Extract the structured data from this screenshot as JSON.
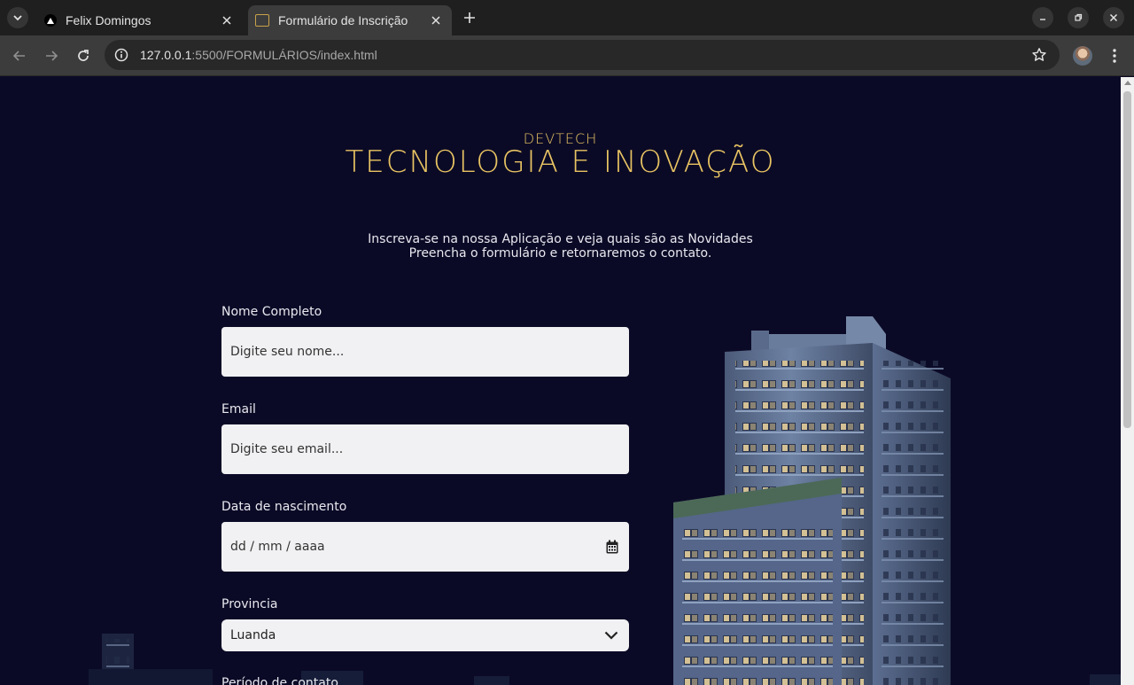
{
  "browser": {
    "tabs": [
      {
        "title": "Felix Domingos",
        "active": false
      },
      {
        "title": "Formulário de Inscrição",
        "active": true
      }
    ],
    "url": {
      "host": "127.0.0.1",
      "rest": ":5500/FORMULÁRIOS/index.html"
    }
  },
  "page": {
    "brand_small": "DEVTECH",
    "brand_title": "TECNOLOGIA E INOVAÇÃO",
    "intro_line1": "Inscreva-se na nossa Aplicação e veja quais são as Novidades",
    "intro_line2": "Preencha o formulário e retornaremos o contato.",
    "form": {
      "name": {
        "label": "Nome Completo",
        "placeholder": "Digite seu nome..."
      },
      "email": {
        "label": "Email",
        "placeholder": "Digite seu email..."
      },
      "birth": {
        "label": "Data de nascimento",
        "placeholder": "dd / mm / aaaa"
      },
      "province": {
        "label": "Provincia",
        "value": "Luanda"
      },
      "period": {
        "label": "Período de contato"
      }
    }
  },
  "colors": {
    "background": "#0b0a26",
    "brand": "#e9c463",
    "field": "#f1f1f3"
  }
}
